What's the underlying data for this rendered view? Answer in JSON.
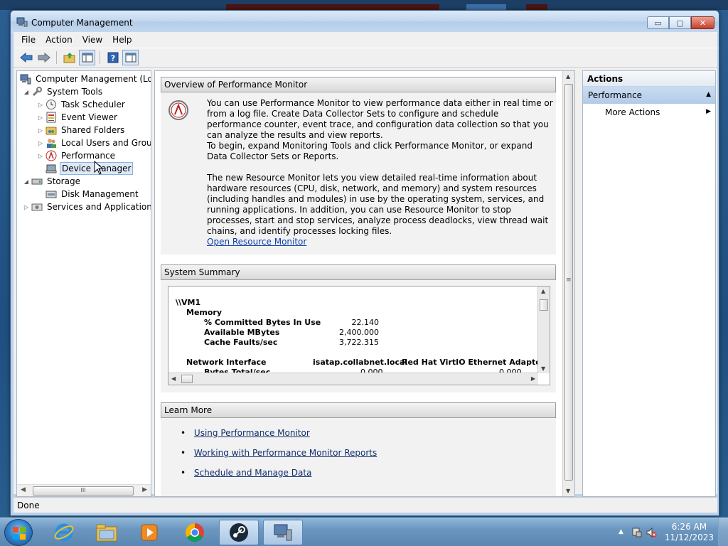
{
  "window": {
    "title": "Computer Management",
    "buttons": {
      "minimize": "▭",
      "maximize": "▢",
      "close": "✕"
    }
  },
  "menu": [
    "File",
    "Action",
    "View",
    "Help"
  ],
  "tree": {
    "root": "Computer Management (Local",
    "system_tools": "System Tools",
    "task_scheduler": "Task Scheduler",
    "event_viewer": "Event Viewer",
    "shared_folders": "Shared Folders",
    "local_users": "Local Users and Groups",
    "performance": "Performance",
    "device_manager": "Device Manager",
    "storage": "Storage",
    "disk_management": "Disk Management",
    "services_apps": "Services and Applications",
    "scroll_grip": "III"
  },
  "overview": {
    "header": "Overview of Performance Monitor",
    "p1": "You can use Performance Monitor to view performance data either in real time or from a log file. Create Data Collector Sets to configure and schedule performance counter, event trace, and configuration data collection so that you can analyze the results and view reports.",
    "p2": "To begin, expand Monitoring Tools and click Performance Monitor, or expand Data Collector Sets or Reports.",
    "p3": "The new Resource Monitor lets you view detailed real-time information about hardware resources (CPU, disk, network, and memory) and system resources (including handles and modules) in use by the operating system, services, and running applications. In addition, you can use Resource Monitor to stop processes, start and stop services, analyze process deadlocks, view thread wait chains, and identify processes locking files.",
    "link": "Open Resource Monitor"
  },
  "summary": {
    "header": "System Summary",
    "machine": "\\\\VM1",
    "memory": "Memory",
    "counters": [
      {
        "name": "% Committed Bytes In Use",
        "value": "22.140"
      },
      {
        "name": "Available MBytes",
        "value": "2,400.000"
      },
      {
        "name": "Cache Faults/sec",
        "value": "3,722.315"
      }
    ],
    "network": "Network Interface",
    "net_col1": "isatap.collabnet.local",
    "net_col2": "Red Hat VirtIO Ethernet Adapter",
    "partial_row": "Bytes Total/sec",
    "partial_v1": "0.000",
    "partial_v2": "0.000"
  },
  "learn": {
    "header": "Learn More",
    "links": [
      "Using Performance Monitor",
      "Working with Performance Monitor Reports",
      "Schedule and Manage Data"
    ]
  },
  "actions": {
    "header": "Actions",
    "group": "Performance",
    "item": "More Actions"
  },
  "status": "Done",
  "clock": {
    "time": "6:26 AM",
    "date": "11/12/2023"
  }
}
